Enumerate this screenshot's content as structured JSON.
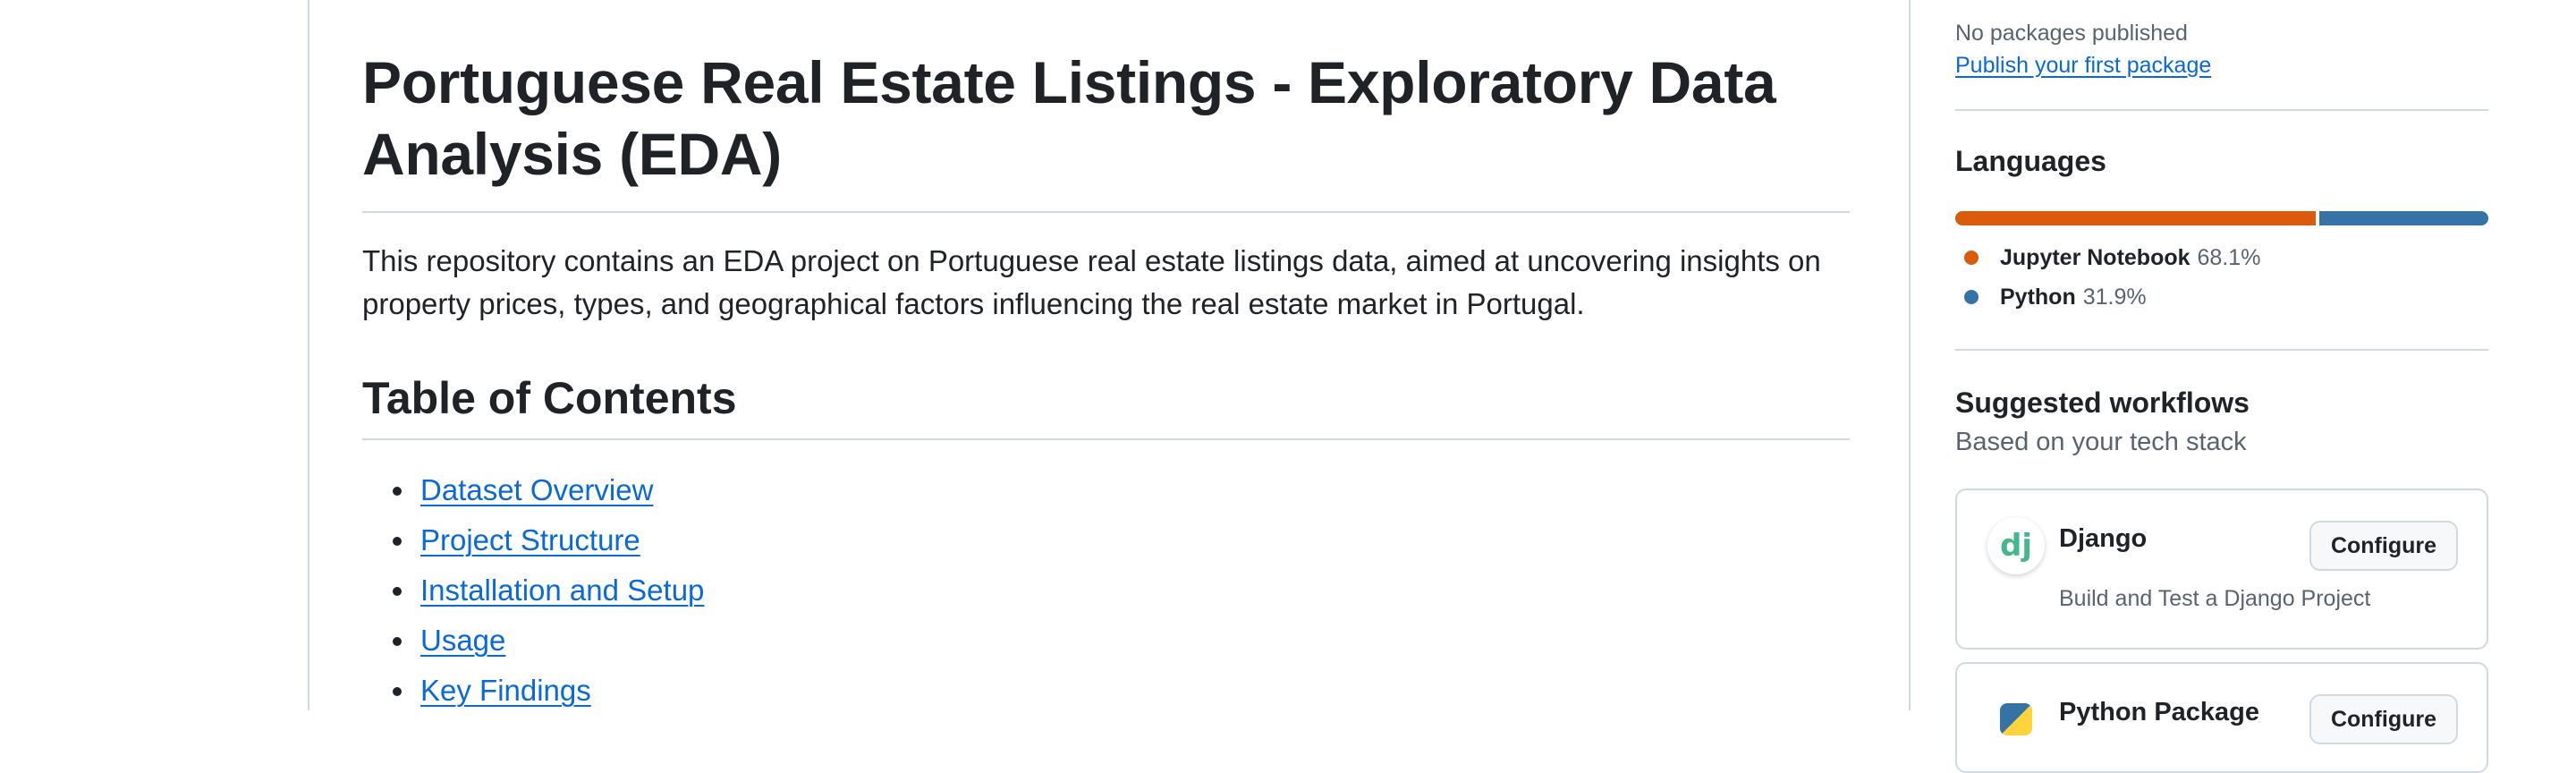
{
  "readme": {
    "title": "Portuguese Real Estate Listings - Exploratory Data Analysis (EDA)",
    "description": "This repository contains an EDA project on Portuguese real estate listings data, aimed at uncovering insights on property prices, types, and geographical factors influencing the real estate market in Portugal.",
    "toc_heading": "Table of Contents",
    "toc": [
      "Dataset Overview",
      "Project Structure",
      "Installation and Setup",
      "Usage",
      "Key Findings"
    ]
  },
  "sidebar": {
    "packages": {
      "status": "No packages published",
      "link": "Publish your first package"
    },
    "languages": {
      "heading": "Languages",
      "items": [
        {
          "name": "Jupyter Notebook",
          "percent": "68.1%",
          "value": 68.1,
          "color": "#DA5B0B"
        },
        {
          "name": "Python",
          "percent": "31.9%",
          "value": 31.9,
          "color": "#3572A5"
        }
      ]
    },
    "workflows": {
      "heading": "Suggested workflows",
      "subheading": "Based on your tech stack",
      "items": [
        {
          "name": "Django",
          "description": "Build and Test a Django Project",
          "button": "Configure",
          "icon": "django-logo-icon",
          "logo_text": "dj"
        },
        {
          "name": "Python Package",
          "button": "Configure",
          "icon": "python-logo-icon"
        }
      ]
    }
  }
}
